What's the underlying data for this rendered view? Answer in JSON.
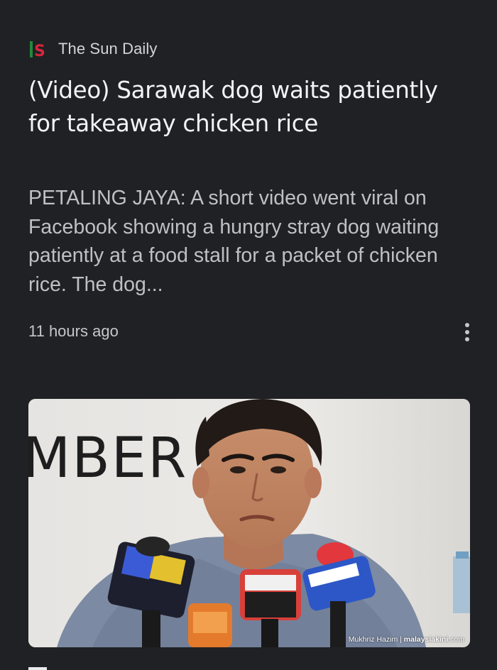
{
  "source": {
    "logo_icon": "the-sun-daily-logo",
    "name": "The Sun Daily"
  },
  "article": {
    "headline": "(Video) Sarawak dog waits patiently for takeaway chicken rice",
    "snippet": "PETALING JAYA: A short video went viral on Facebook showing a hungry stray dog waiting patiently at a food stall for a packet of chicken rice. The dog...",
    "time": "11 hours ago",
    "more_icon": "more-vert-icon"
  },
  "image": {
    "backdrop_text": "MBER 2",
    "credit_name": "Mukhriz Hazim",
    "credit_separator": " | ",
    "credit_site": "malaysiakini",
    "credit_domain": ".com"
  },
  "colors": {
    "background": "#202124",
    "headline": "#f1f3f4",
    "snippet": "#bdc1c6",
    "logo_green": "#1f8a3b",
    "logo_red": "#d7263d"
  }
}
